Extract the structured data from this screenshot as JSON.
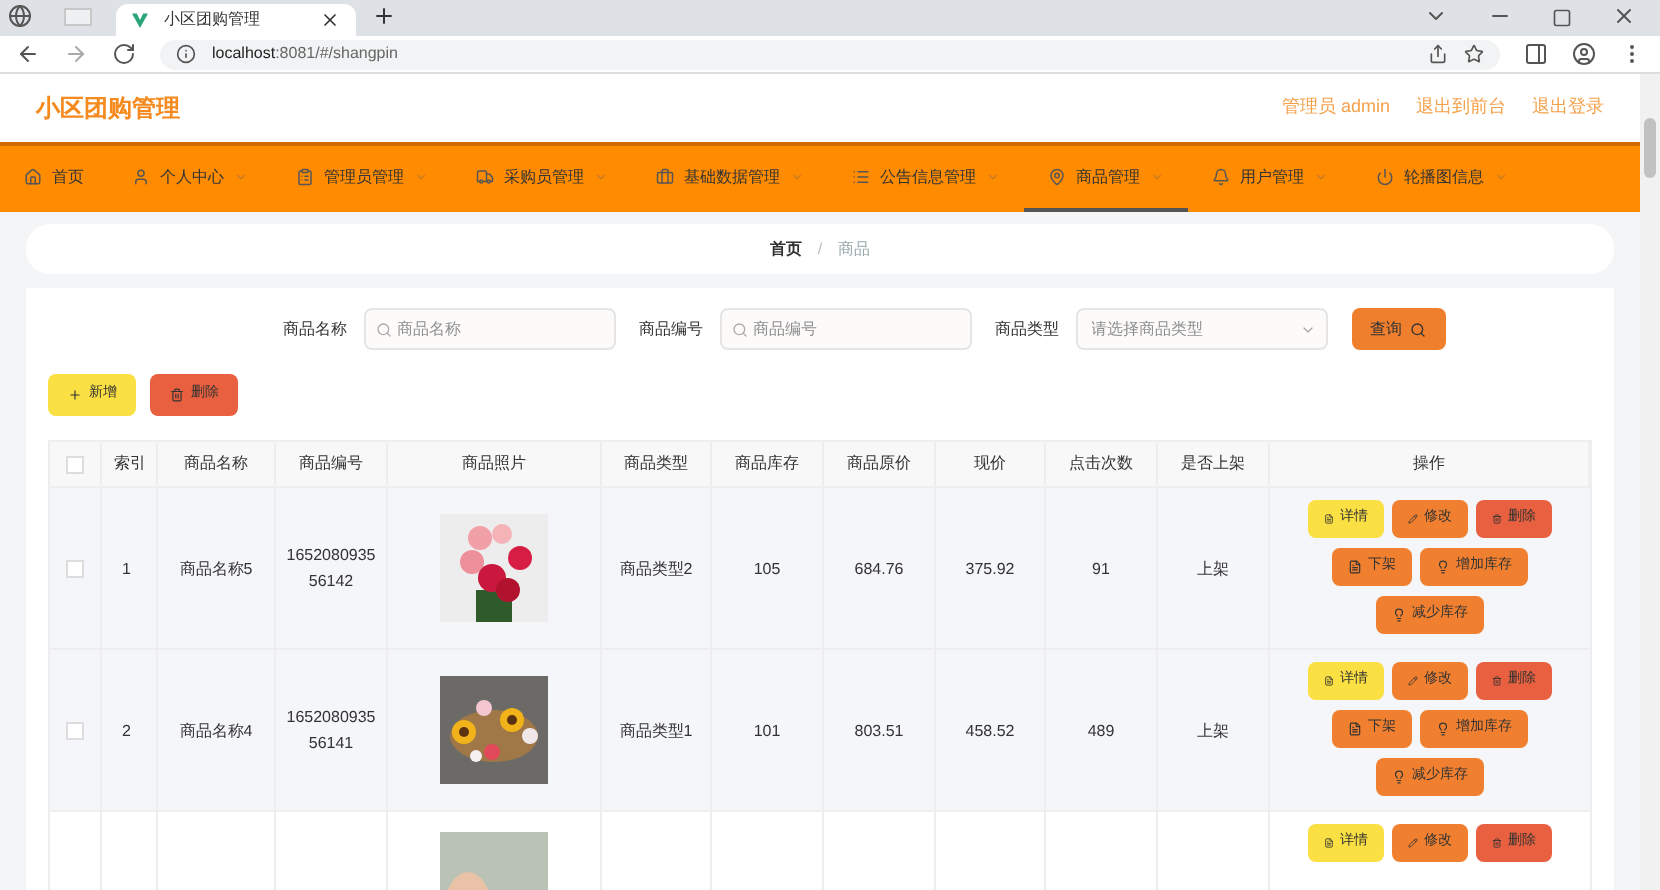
{
  "browser": {
    "tab_title": "小区团购管理",
    "url_host": "localhost",
    "url_rest": ":8081/#/shangpin"
  },
  "header": {
    "title": "小区团购管理",
    "links": [
      "管理员 admin",
      "退出到前台",
      "退出登录"
    ]
  },
  "nav": [
    {
      "label": "首页",
      "dropdown": false,
      "selected": false
    },
    {
      "label": "个人中心",
      "dropdown": true,
      "selected": false
    },
    {
      "label": "管理员管理",
      "dropdown": true,
      "selected": false
    },
    {
      "label": "采购员管理",
      "dropdown": true,
      "selected": false
    },
    {
      "label": "基础数据管理",
      "dropdown": true,
      "selected": false
    },
    {
      "label": "公告信息管理",
      "dropdown": true,
      "selected": false
    },
    {
      "label": "商品管理",
      "dropdown": true,
      "selected": true
    },
    {
      "label": "用户管理",
      "dropdown": true,
      "selected": false
    },
    {
      "label": "轮播图信息",
      "dropdown": true,
      "selected": false
    }
  ],
  "breadcrumb": {
    "items": [
      "首页",
      "商品"
    ],
    "separator": "/"
  },
  "search": {
    "fields": [
      {
        "label": "商品名称",
        "placeholder": "商品名称",
        "kind": "text"
      },
      {
        "label": "商品编号",
        "placeholder": "商品编号",
        "kind": "text"
      },
      {
        "label": "商品类型",
        "placeholder": "请选择商品类型",
        "kind": "select"
      }
    ],
    "button": "查询"
  },
  "toolbar": [
    {
      "label": "新增",
      "kind": "add"
    },
    {
      "label": "删除",
      "kind": "delete"
    }
  ],
  "table": {
    "select_all_checked": false,
    "columns": [
      "索引",
      "商品名称",
      "商品编号",
      "商品照片",
      "商品类型",
      "商品库存",
      "商品原价",
      "现价",
      "点击次数",
      "是否上架",
      "操作"
    ],
    "rows": [
      {
        "checked": false,
        "cells": [
          "1",
          "商品名称5",
          "165208093556142",
          "",
          "商品类型2",
          "105",
          "684.76",
          "375.92",
          "91",
          "上架"
        ],
        "actions": [
          {
            "label": "详情",
            "kind": "detail"
          },
          {
            "label": "修改",
            "kind": "edit"
          },
          {
            "label": "删除",
            "kind": "delete"
          },
          {
            "label": "下架",
            "kind": "off"
          },
          {
            "label": "增加库存",
            "kind": "stock"
          },
          {
            "label": "减少库存",
            "kind": "stock"
          }
        ]
      },
      {
        "checked": false,
        "cells": [
          "2",
          "商品名称4",
          "165208093556141",
          "",
          "商品类型1",
          "101",
          "803.51",
          "458.52",
          "489",
          "上架"
        ],
        "actions": [
          {
            "label": "详情",
            "kind": "detail"
          },
          {
            "label": "修改",
            "kind": "edit"
          },
          {
            "label": "删除",
            "kind": "delete"
          },
          {
            "label": "下架",
            "kind": "off"
          },
          {
            "label": "增加库存",
            "kind": "stock"
          },
          {
            "label": "减少库存",
            "kind": "stock"
          }
        ]
      },
      {
        "cells": [
          "",
          "",
          "",
          "",
          "",
          "",
          "",
          "",
          "",
          ""
        ],
        "actions": [
          {
            "label": "详情",
            "kind": "detail"
          },
          {
            "label": "修改",
            "kind": "edit"
          },
          {
            "label": "删除",
            "kind": "delete"
          }
        ]
      }
    ]
  }
}
